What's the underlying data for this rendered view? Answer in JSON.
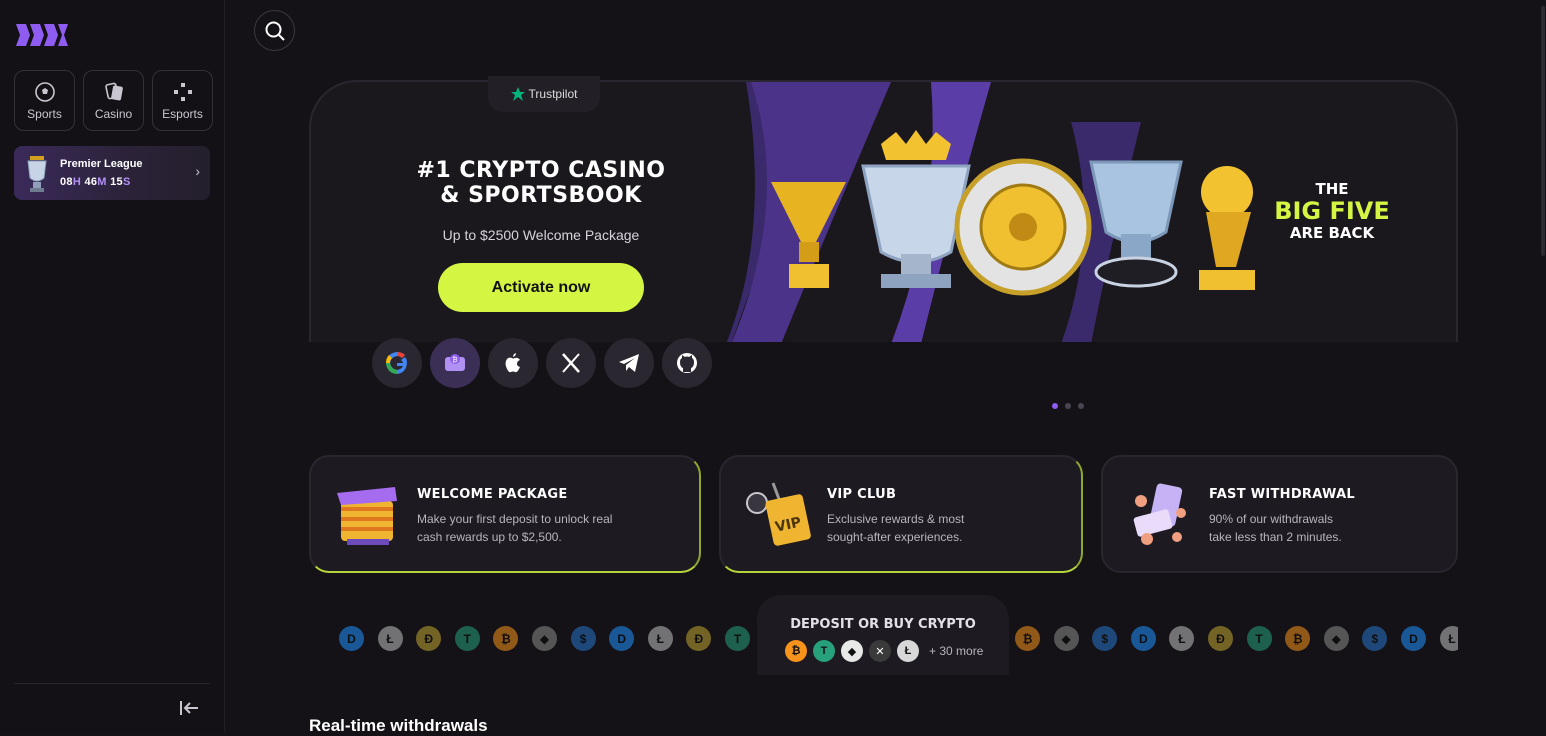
{
  "sidebar": {
    "logo_icon": "brand-logo",
    "nav": [
      {
        "label": "Sports",
        "icon": "soccer-ball-icon"
      },
      {
        "label": "Casino",
        "icon": "cards-icon"
      },
      {
        "label": "Esports",
        "icon": "gamepad-icon"
      }
    ],
    "promo": {
      "title": "Premier League",
      "hours": "08",
      "hours_unit": "H",
      "minutes": "46",
      "minutes_unit": "M",
      "seconds": "15",
      "seconds_unit": "S",
      "arrow": "›"
    }
  },
  "hero": {
    "trustpilot": "Trustpilot",
    "title_line1": "#1 CRYPTO CASINO",
    "title_line2": "& SPORTSBOOK",
    "subtitle": "Up to $2500 Welcome Package",
    "cta": "Activate now",
    "socials": [
      "google-icon",
      "wallet-icon",
      "apple-icon",
      "x-icon",
      "telegram-icon",
      "github-icon"
    ],
    "banner_line1": "THE",
    "banner_line2": "BIG FIVE",
    "banner_line3": "ARE BACK",
    "slides": 3,
    "active_slide": 1
  },
  "cards": [
    {
      "title": "WELCOME PACKAGE",
      "line1": "Make your first deposit to unlock real",
      "line2": "cash rewards up to $2,500."
    },
    {
      "title": "VIP CLUB",
      "line1": "Exclusive rewards & most",
      "line2": "sought-after experiences."
    },
    {
      "title": "FAST WITHDRAWAL",
      "line1": "90% of our withdrawals",
      "line2": "take less than 2 minutes."
    }
  ],
  "deposit": {
    "title": "DEPOSIT OR BUY CRYPTO",
    "more": "+ 30 more"
  },
  "coins": [
    {
      "sym": "D",
      "color": "#1e90ff"
    },
    {
      "sym": "Ł",
      "color": "#bfbfbf"
    },
    {
      "sym": "Ð",
      "color": "#c2a633"
    },
    {
      "sym": "T",
      "color": "#26a17b"
    },
    {
      "sym": "₿",
      "color": "#f7931a"
    },
    {
      "sym": "◆",
      "color": "#8c8c8c"
    },
    {
      "sym": "$",
      "color": "#2775ca"
    },
    {
      "sym": "D",
      "color": "#1e90ff"
    },
    {
      "sym": "Ł",
      "color": "#bfbfbf"
    },
    {
      "sym": "Ð",
      "color": "#c2a633"
    },
    {
      "sym": "T",
      "color": "#26a17b"
    }
  ],
  "coins_right": [
    {
      "sym": "₿",
      "color": "#f7931a"
    },
    {
      "sym": "◆",
      "color": "#8c8c8c"
    },
    {
      "sym": "$",
      "color": "#2775ca"
    },
    {
      "sym": "D",
      "color": "#1e90ff"
    },
    {
      "sym": "Ł",
      "color": "#bfbfbf"
    },
    {
      "sym": "Ð",
      "color": "#c2a633"
    },
    {
      "sym": "T",
      "color": "#26a17b"
    },
    {
      "sym": "₿",
      "color": "#f7931a"
    },
    {
      "sym": "◆",
      "color": "#8c8c8c"
    },
    {
      "sym": "$",
      "color": "#2775ca"
    },
    {
      "sym": "D",
      "color": "#1e90ff"
    },
    {
      "sym": "Ł",
      "color": "#bfbfbf"
    }
  ],
  "deposit_coins": [
    {
      "sym": "₿",
      "color": "#f7931a"
    },
    {
      "sym": "T",
      "color": "#26a17b"
    },
    {
      "sym": "◆",
      "color": "#e8e8e8"
    },
    {
      "sym": "✕",
      "color": "#3a3a3a"
    },
    {
      "sym": "Ł",
      "color": "#d8d8d8"
    }
  ],
  "realtime": {
    "title": "Real-time withdrawals"
  },
  "colors": {
    "accent": "#d4f542",
    "brand": "#8e5cf0"
  }
}
